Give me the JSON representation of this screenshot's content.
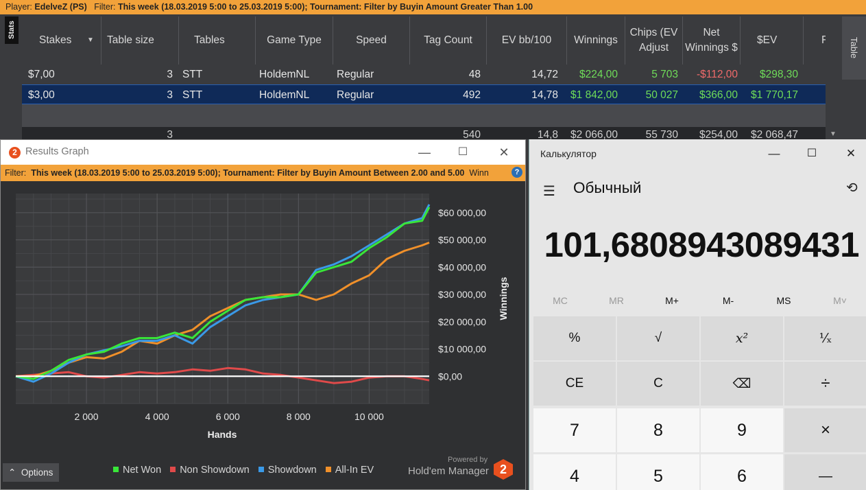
{
  "hm": {
    "filter_bar": {
      "player_label": "Player:",
      "player_value": "EdelveZ (PS)",
      "filter_label": "Filter:",
      "filter_value": "This week (18.03.2019 5:00 to 25.03.2019 5:00); Tournament: Filter by Buyin Amount Greater Than 1.00"
    },
    "stats_tab": "Stats",
    "table_tab": "Table",
    "columns": {
      "stakes": "Stakes",
      "table_size": "Table size",
      "tables": "Tables",
      "game_type": "Game Type",
      "speed": "Speed",
      "tag_count": "Tag Count",
      "ev_bb100": "EV bb/100",
      "winnings": "Winnings",
      "chips": "Chips (EV Adjust",
      "net_winnings": "Net Winnings $",
      "sev": "$EV",
      "f": "F"
    },
    "rows": [
      {
        "stakes": "$7,00",
        "table_size": "3",
        "tables": "STT",
        "game_type": "HoldemNL",
        "speed": "Regular",
        "tag_count": "48",
        "ev_bb100": "14,72",
        "winnings": "$224,00",
        "chips": "5 703",
        "net_winnings": "-$112,00",
        "sev": "$298,30"
      },
      {
        "stakes": "$3,00",
        "table_size": "3",
        "tables": "STT",
        "game_type": "HoldemNL",
        "speed": "Regular",
        "tag_count": "492",
        "ev_bb100": "14,78",
        "winnings": "$1 842,00",
        "chips": "50 027",
        "net_winnings": "$366,00",
        "sev": "$1 770,17"
      }
    ],
    "total": {
      "table_size": "3",
      "tag_count": "540",
      "ev_bb100": "14,8",
      "winnings": "$2 066,00",
      "chips": "55 730",
      "net_winnings": "$254,00",
      "sev": "$2 068,47"
    }
  },
  "results_graph": {
    "title": "Results Graph",
    "logo_text": "2",
    "filter_label": "Filter:",
    "filter_value": "This week (18.03.2019 5:00 to 25.03.2019 5:00); Tournament: Filter by Buyin Amount  Between 2.00 and 5.00",
    "filter_suffix": "Winn",
    "options_label": "Options",
    "powered_by": "Powered by",
    "hm_brand": "Hold'em Manager",
    "legend": {
      "net_won": "Net Won",
      "non_showdown": "Non Showdown",
      "showdown": "Showdown",
      "all_in_ev": "All-In EV"
    },
    "colors": {
      "net_won": "#39e639",
      "non_showdown": "#e04a4a",
      "showdown": "#3a9ae8",
      "all_in_ev": "#f0902a"
    }
  },
  "chart_data": {
    "type": "line",
    "xlabel": "Hands",
    "ylabel": "Winnings",
    "xlim": [
      0,
      11700
    ],
    "ylim": [
      -10000,
      67000
    ],
    "x_ticks": [
      "2 000",
      "4 000",
      "6 000",
      "8 000",
      "10 000"
    ],
    "x_tick_values": [
      2000,
      4000,
      6000,
      8000,
      10000
    ],
    "y_ticks": [
      "$0,00",
      "$10 000,00",
      "$20 000,00",
      "$30 000,00",
      "$40 000,00",
      "$50 000,00",
      "$60 000,00"
    ],
    "y_tick_values": [
      0,
      10000,
      20000,
      30000,
      40000,
      50000,
      60000
    ],
    "grid": true,
    "legend_position": "bottom",
    "x": [
      0,
      500,
      1000,
      1500,
      2000,
      2500,
      3000,
      3500,
      4000,
      4500,
      5000,
      5500,
      6000,
      6500,
      7000,
      7500,
      8000,
      8500,
      9000,
      9500,
      10000,
      10500,
      11000,
      11500,
      11700
    ],
    "series": [
      {
        "name": "Net Won",
        "values": [
          0,
          -1000,
          2000,
          6000,
          8000,
          9000,
          12000,
          14000,
          14000,
          16000,
          14000,
          20000,
          24000,
          28000,
          29000,
          29000,
          30000,
          38000,
          40000,
          42000,
          47000,
          51000,
          56000,
          57000,
          62000
        ]
      },
      {
        "name": "Non Showdown",
        "values": [
          0,
          500,
          1000,
          1500,
          0,
          -500,
          500,
          1500,
          1000,
          1500,
          2500,
          2000,
          3000,
          2500,
          1000,
          500,
          -500,
          -1500,
          -2500,
          -2000,
          -500,
          0,
          0,
          -1000,
          -1500
        ]
      },
      {
        "name": "Showdown",
        "values": [
          0,
          -2000,
          1000,
          5000,
          8000,
          9500,
          11000,
          13000,
          13000,
          15000,
          12000,
          18000,
          22000,
          26000,
          28000,
          29000,
          30000,
          39000,
          41000,
          44000,
          48000,
          52000,
          56000,
          58000,
          63000
        ]
      },
      {
        "name": "All-In EV",
        "values": [
          0,
          0,
          2000,
          5000,
          7000,
          6500,
          9000,
          13000,
          12000,
          15000,
          17000,
          22000,
          25000,
          28000,
          29000,
          30000,
          30000,
          28000,
          30000,
          34000,
          37000,
          43000,
          46000,
          48000,
          49000
        ]
      }
    ]
  },
  "calculator": {
    "title": "Калькулятор",
    "mode": "Обычный",
    "display": "101,6808943089431",
    "memory": [
      "MC",
      "MR",
      "M+",
      "M-",
      "MS",
      "M˅"
    ],
    "keys": {
      "percent": "%",
      "sqrt": "√",
      "square": "x²",
      "reciprocal": "¹⁄ₓ",
      "ce": "CE",
      "c": "C",
      "backspace": "⌫",
      "divide": "÷",
      "seven": "7",
      "eight": "8",
      "nine": "9",
      "multiply": "×",
      "four": "4",
      "five": "5",
      "six": "6",
      "minus": "—"
    }
  }
}
